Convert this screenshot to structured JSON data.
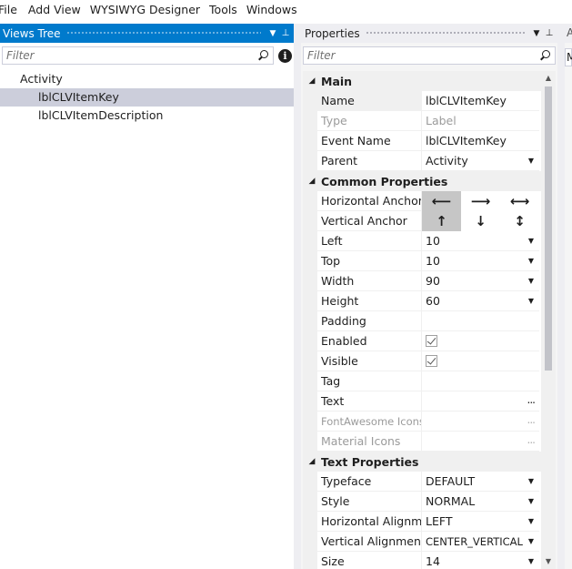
{
  "menu": [
    "File",
    "Add View",
    "WYSIWYG Designer",
    "Tools",
    "Windows"
  ],
  "views_tree": {
    "title": "Views Tree",
    "filter_placeholder": "Filter",
    "items": [
      {
        "label": "Activity",
        "level": 0,
        "selected": false
      },
      {
        "label": "lblCLVItemKey",
        "level": 1,
        "selected": true
      },
      {
        "label": "lblCLVItemDescription",
        "level": 1,
        "selected": false
      }
    ]
  },
  "properties": {
    "title": "Properties",
    "filter_placeholder": "Filter",
    "categories": {
      "main": "Main",
      "common": "Common Properties",
      "text": "Text Properties"
    },
    "main": {
      "name_label": "Name",
      "name_value": "lblCLVItemKey",
      "type_label": "Type",
      "type_value": "Label",
      "event_label": "Event Name",
      "event_value": "lblCLVItemKey",
      "parent_label": "Parent",
      "parent_value": "Activity"
    },
    "common": {
      "h_anchor_label": "Horizontal Anchor",
      "v_anchor_label": "Vertical Anchor",
      "left_label": "Left",
      "left_value": "10",
      "top_label": "Top",
      "top_value": "10",
      "width_label": "Width",
      "width_value": "90",
      "height_label": "Height",
      "height_value": "60",
      "padding_label": "Padding",
      "enabled_label": "Enabled",
      "visible_label": "Visible",
      "tag_label": "Tag",
      "text_label": "Text",
      "fa_label": "FontAwesome Icons",
      "mat_label": "Material Icons"
    },
    "text": {
      "typeface_label": "Typeface",
      "typeface_value": "DEFAULT",
      "style_label": "Style",
      "style_value": "NORMAL",
      "halign_label": "Horizontal Alignm...",
      "halign_value": "LEFT",
      "valign_label": "Vertical Alignment",
      "valign_value": "CENTER_VERTICAL",
      "size_label": "Size",
      "size_value": "14"
    }
  },
  "right_panel": {
    "title_fragment": "A",
    "field_fragment": "M"
  },
  "colors": {
    "accent": "#007acc",
    "selection": "#cccedb"
  }
}
